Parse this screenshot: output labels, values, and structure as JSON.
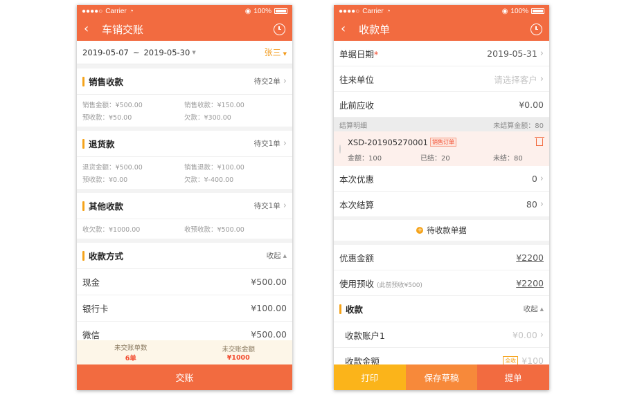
{
  "colors": {
    "primary": "#f26b40",
    "accent_yellow": "#f5a31a",
    "red": "#f24b2e",
    "print_btn": "#fbb41a",
    "draft_btn": "#f7893a"
  },
  "statusbar": {
    "carrier": "Carrier",
    "battery": "100%"
  },
  "left": {
    "title": "车销交账",
    "date_start": "2019-05-07",
    "date_sep": "~",
    "date_end": "2019-05-30",
    "person": "张三",
    "sales": {
      "title": "销售收款",
      "status": "待交2单",
      "items": [
        "销售金额：¥500.00",
        "销售收款：¥150.00",
        "预收款：¥50.00",
        "欠款：¥300.00"
      ]
    },
    "returns": {
      "title": "退货款",
      "status": "待交1单",
      "items": [
        "退货金额：¥500.00",
        "销售退款：¥100.00",
        "预收款：¥0.00",
        "欠款：¥-400.00"
      ]
    },
    "other": {
      "title": "其他收款",
      "status": "待交1单",
      "items": [
        "收欠款：¥1000.00",
        "收预收款：¥500.00"
      ]
    },
    "payment": {
      "title": "收款方式",
      "toggle": "收起",
      "rows": [
        {
          "label": "现金",
          "amount": "¥500.00"
        },
        {
          "label": "银行卡",
          "amount": "¥100.00"
        },
        {
          "label": "微信",
          "amount": "¥500.00"
        }
      ]
    },
    "summary": {
      "unsettled_count_label": "未交账单数",
      "unsettled_count": "6单",
      "unsettled_amount_label": "未交账金额",
      "unsettled_amount": "¥1000"
    },
    "submit": "交账"
  },
  "right": {
    "title": "收款单",
    "doc_date_label": "单据日期",
    "doc_date_req": "*",
    "doc_date": "2019-05-31",
    "partner_label": "往来单位",
    "partner_placeholder": "请选择客户",
    "prev_receivable_label": "此前应收",
    "prev_receivable": "¥0.00",
    "settle_detail_label": "结算明细",
    "unsettled_total_label": "未结算金额：80",
    "order": {
      "number": "XSD-201905270001",
      "tag": "销售订单",
      "amount": "金额：100",
      "settled": "已结：20",
      "unsettled": "未结：80"
    },
    "discount_label": "本次优惠",
    "discount": "0",
    "settle_label": "本次结算",
    "settle": "80",
    "pending_docs": "待收款单据",
    "discount_amount_label": "优惠金额",
    "discount_amount": "¥2200",
    "use_prepay_label": "使用预收",
    "use_prepay_hint": "(此前预收¥500)",
    "use_prepay": "¥2200",
    "receipt": {
      "title": "收款",
      "toggle": "收起"
    },
    "account_label": "收款账户1",
    "account_value": "¥0.00",
    "receipt_amount_label": "收款金额",
    "receipt_amount_tag": "全收",
    "receipt_amount": "¥100",
    "buttons": {
      "print": "打印",
      "save_draft": "保存草稿",
      "submit": "提单"
    }
  }
}
